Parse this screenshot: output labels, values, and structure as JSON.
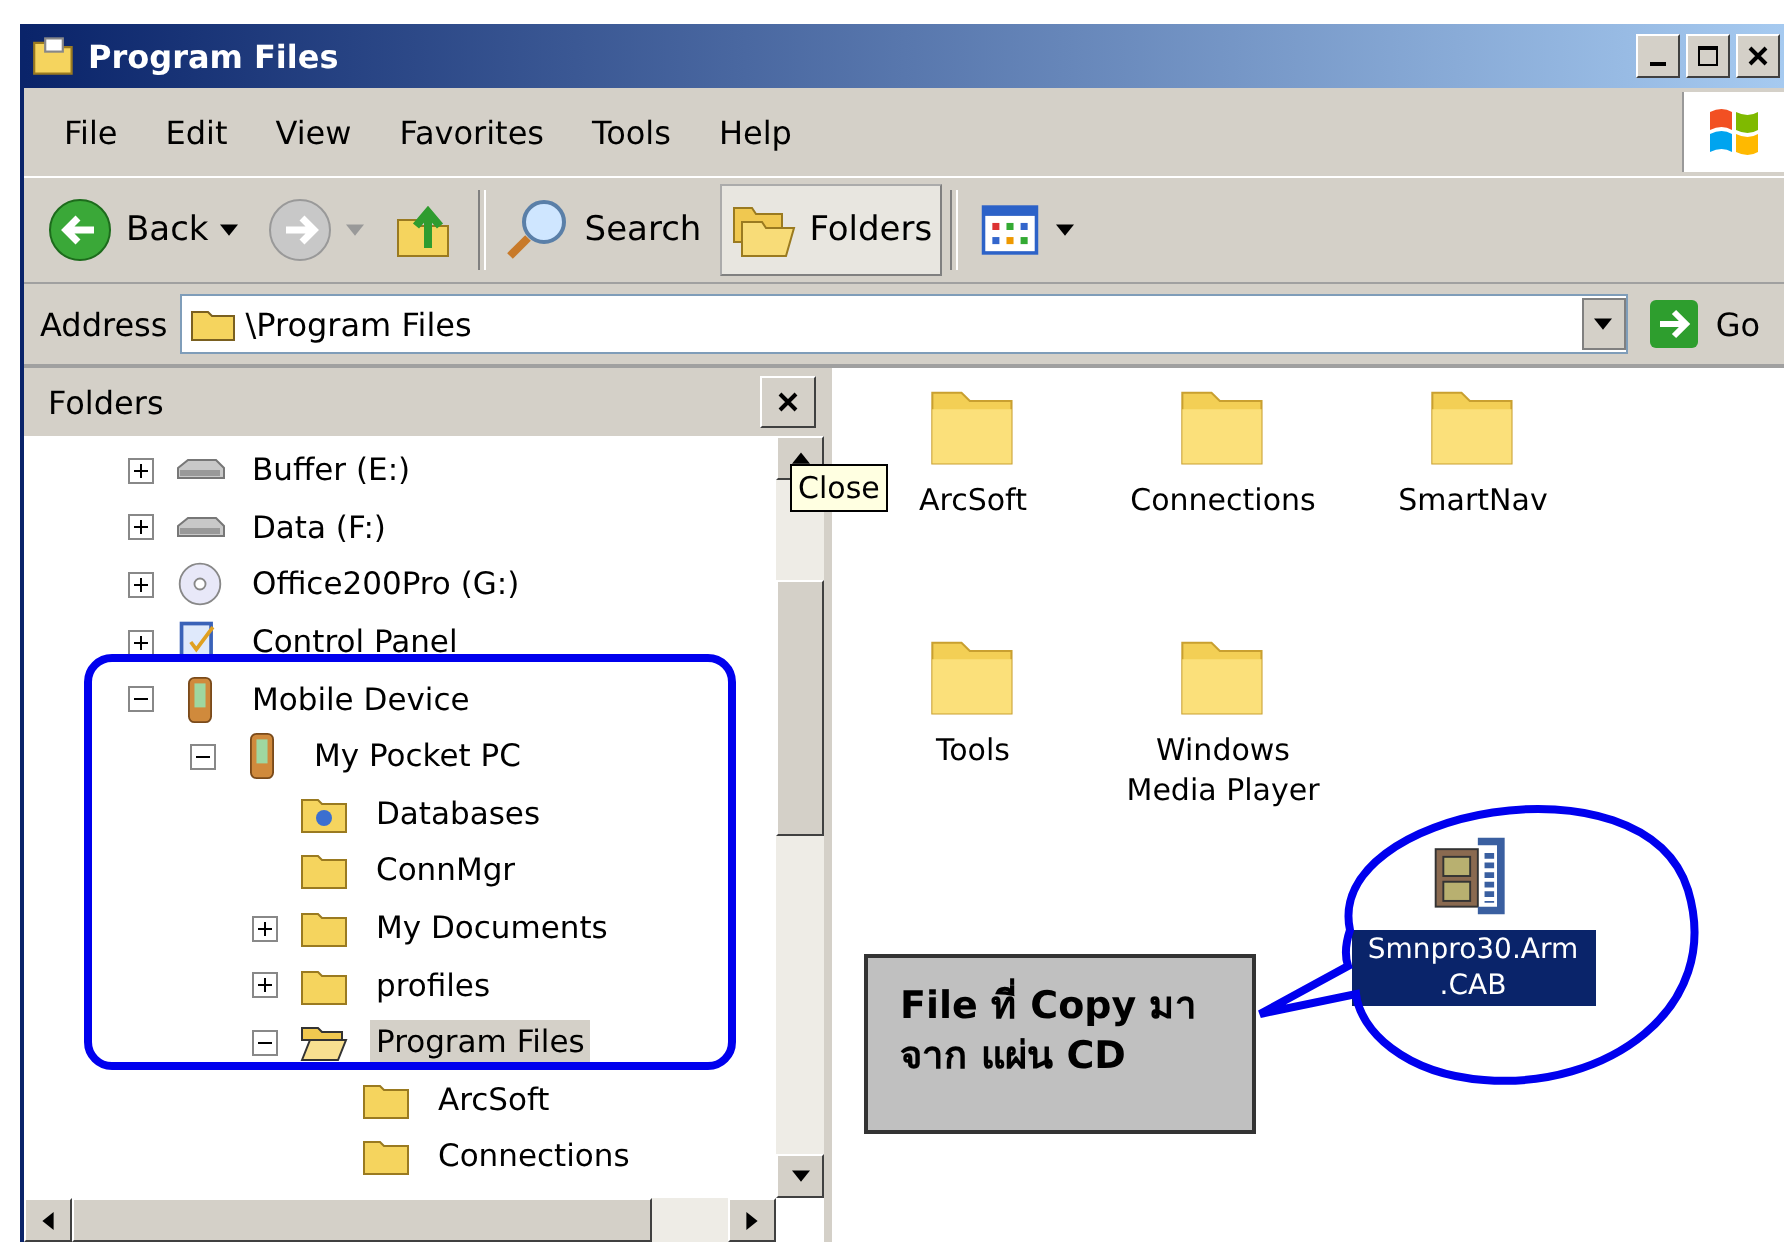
{
  "window": {
    "title": "Program Files"
  },
  "menu": [
    "File",
    "Edit",
    "View",
    "Favorites",
    "Tools",
    "Help"
  ],
  "toolbar": [
    {
      "kind": "back",
      "label": "Back",
      "selected": false
    },
    {
      "kind": "forward",
      "selected": false
    },
    {
      "kind": "up",
      "selected": false
    },
    {
      "kind": "search",
      "label": "Search",
      "selected": false
    },
    {
      "kind": "folders",
      "label": "Folders",
      "selected": true
    },
    {
      "kind": "views",
      "selected": false
    }
  ],
  "address": {
    "label": "Address",
    "value": "\\Program Files",
    "go": "Go"
  },
  "folders_pane": {
    "title": "Folders",
    "tooltip": "Close"
  },
  "tree": {
    "items": [
      {
        "label": "Buffer (E:)",
        "kind": "drive",
        "expanded": false,
        "selected": false
      },
      {
        "label": "Data (F:)",
        "kind": "drive",
        "expanded": false,
        "selected": false
      },
      {
        "label": "Office200Pro (G:)",
        "kind": "cd",
        "expanded": false,
        "selected": false
      },
      {
        "label": "Control Panel",
        "kind": "control-panel",
        "expanded": false,
        "selected": false
      },
      {
        "label": "Mobile Device",
        "kind": "device",
        "expanded": true,
        "selected": false,
        "children": [
          {
            "label": "My Pocket PC",
            "kind": "device",
            "expanded": true,
            "selected": false,
            "children": [
              {
                "label": "Databases",
                "kind": "db-folder",
                "selected": false
              },
              {
                "label": "ConnMgr",
                "kind": "folder",
                "selected": false
              },
              {
                "label": "My Documents",
                "kind": "folder",
                "expanded": false,
                "selected": false
              },
              {
                "label": "profiles",
                "kind": "folder",
                "expanded": false,
                "selected": false
              },
              {
                "label": "Program Files",
                "kind": "open-folder",
                "expanded": true,
                "selected": true,
                "children": [
                  {
                    "label": "ArcSoft",
                    "kind": "folder",
                    "selected": false
                  },
                  {
                    "label": "Connections",
                    "kind": "folder",
                    "selected": false
                  }
                ]
              }
            ]
          }
        ]
      }
    ]
  },
  "files": [
    {
      "name": "ArcSoft",
      "kind": "folder",
      "selected": false
    },
    {
      "name": "Connections",
      "kind": "folder",
      "selected": false
    },
    {
      "name": "SmartNav",
      "kind": "folder",
      "selected": false
    },
    {
      "name": "Tools",
      "kind": "folder",
      "selected": false
    },
    {
      "name": "Windows Media Player",
      "kind": "folder",
      "selected": false
    },
    {
      "name": "Smnpro30.Arm .CAB",
      "kind": "cab",
      "selected": true
    }
  ],
  "callout": {
    "text": "File ที่ Copy มา จาก แผ่น CD"
  }
}
